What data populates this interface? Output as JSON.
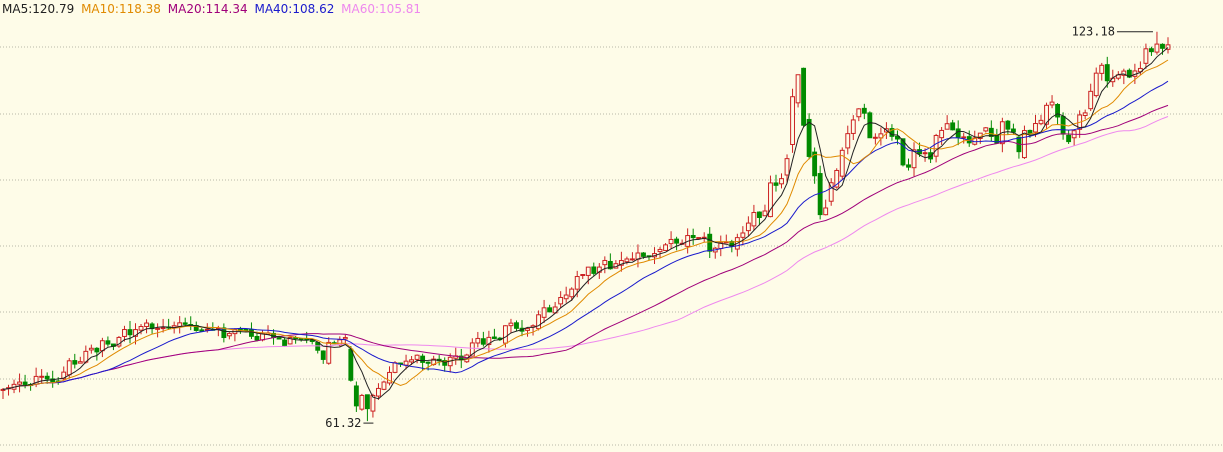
{
  "chart_data": {
    "type": "candlestick",
    "legend": [
      {
        "key": "MA5",
        "label": "MA5:120.79",
        "color": "#222222"
      },
      {
        "key": "MA10",
        "label": "MA10:118.38",
        "color": "#e08a00"
      },
      {
        "key": "MA20",
        "label": "MA20:114.34",
        "color": "#a0007a"
      },
      {
        "key": "MA40",
        "label": "MA40:108.62",
        "color": "#1a1acc"
      },
      {
        "key": "MA60",
        "label": "MA60:105.81",
        "color": "#ee88ee"
      }
    ],
    "ma_colors": {
      "MA5": "#222222",
      "MA10": "#e08a00",
      "MA20": "#1a1acc",
      "MA40": "#a0007a",
      "MA60": "#ee88ee"
    },
    "candle_colors": {
      "up": "#cc2222",
      "down": "#008a00"
    },
    "grid": true,
    "high_label": "123.18",
    "low_label": "61.32",
    "high": 123.18,
    "low": 61.32,
    "closes": [
      66.35,
      66.63,
      67.16,
      67.52,
      67.14,
      67.04,
      68.42,
      68.44,
      68.02,
      67.54,
      67.68,
      69.1,
      70.9,
      70.38,
      70.76,
      72.4,
      72.89,
      72.32,
      74.09,
      73.56,
      73.19,
      74.61,
      75.87,
      75.05,
      75.86,
      76.35,
      76.9,
      76.02,
      76.05,
      76.18,
      76.11,
      76.47,
      76.93,
      76.7,
      76.49,
      75.72,
      75.63,
      75.91,
      75.85,
      76.06,
      74.6,
      75.25,
      75.93,
      75.84,
      75.76,
      74.79,
      74.21,
      75.21,
      75.33,
      74.59,
      74.36,
      73.26,
      74.59,
      74.45,
      74.28,
      74.24,
      73.97,
      72.58,
      71.12,
      73.82,
      73.68,
      74.24,
      74.59,
      67.81,
      63.74,
      65.4,
      63.3,
      65.4,
      66.51,
      67.53,
      69.05,
      70.59,
      70.44,
      70.84,
      71.06,
      71.79,
      70.65,
      70.51,
      71.17,
      70.9,
      70.19,
      71.46,
      71.68,
      71.04,
      71.82,
      73.74,
      74.45,
      73.54,
      74.62,
      74.45,
      74.27,
      76.47,
      76.88,
      76.06,
      75.61,
      76.02,
      76.47,
      78.21,
      79.32,
      78.68,
      79.45,
      80.96,
      81.35,
      82.29,
      84.29,
      84.61,
      85.78,
      84.79,
      85.79,
      86.84,
      85.53,
      86.33,
      86.83,
      87.08,
      87.09,
      88.03,
      87.49,
      87.47,
      87.94,
      88.59,
      89.32,
      90.18,
      89.6,
      89.57,
      90.8,
      90.47,
      90.48,
      90.53,
      88.32,
      88.79,
      89.67,
      89.8,
      89.15,
      90.47,
      91.21,
      92.78,
      94.46,
      93.67,
      94.7,
      99.16,
      98.78,
      99.84,
      103.02,
      112.86,
      116.35,
      108.33,
      103.37,
      100.3,
      94.13,
      95.18,
      99.19,
      101.14,
      104.34,
      106.99,
      109.17,
      110.93,
      110.24,
      106.34,
      106.41,
      106.96,
      107.77,
      106.56,
      106.14,
      102.03,
      101.67,
      104.42,
      103.79,
      103.96,
      102.98,
      106.7,
      107.5,
      108.57,
      107.6,
      106.43,
      106.47,
      105.53,
      106.3,
      107.07,
      107.92,
      106.55,
      105.48,
      108.88,
      107.71,
      107.24,
      104.13,
      107.48,
      106.99,
      108.6,
      109.1,
      111.49,
      112.0,
      109.64,
      106.92,
      105.73,
      107.46,
      109.96,
      110.29,
      113.71,
      116.6,
      117.85,
      115.4,
      115.79,
      116.33,
      116.93,
      115.98,
      116.95,
      117.35,
      120.47,
      120.02,
      121.22,
      120.55,
      121.1
    ],
    "ma_levels": {
      "MA5": 120.79,
      "MA10": 118.38,
      "MA20": 114.34,
      "MA40": 108.62,
      "MA60": 105.81
    }
  }
}
